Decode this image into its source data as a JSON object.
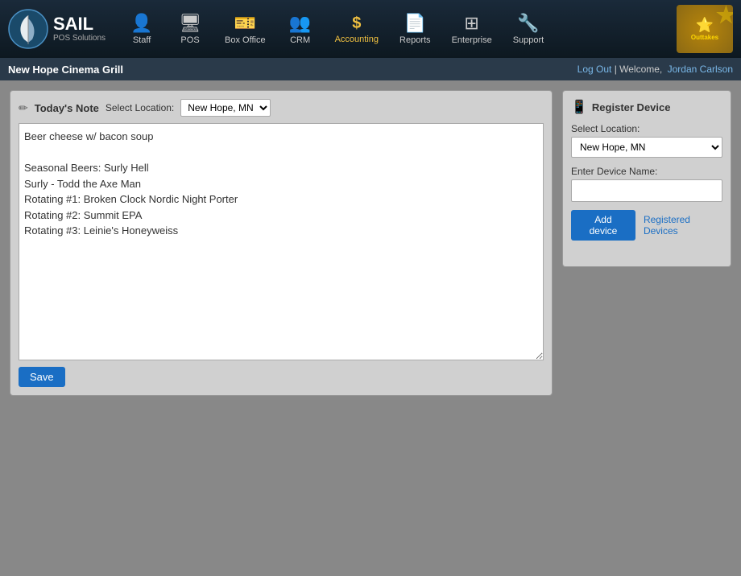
{
  "header": {
    "brand": "SAIL",
    "sub": "POS Solutions",
    "badge_text": "Outtakes",
    "nav": [
      {
        "label": "Staff",
        "icon": "👤",
        "id": "staff"
      },
      {
        "label": "POS",
        "icon": "🖥",
        "id": "pos"
      },
      {
        "label": "Box Office",
        "icon": "🎫",
        "id": "boxoffice"
      },
      {
        "label": "CRM",
        "icon": "👥",
        "id": "crm"
      },
      {
        "label": "Accounting",
        "icon": "$",
        "id": "accounting",
        "active": true
      },
      {
        "label": "Reports",
        "icon": "📄",
        "id": "reports"
      },
      {
        "label": "Enterprise",
        "icon": "🏢",
        "id": "enterprise"
      },
      {
        "label": "Support",
        "icon": "🔧",
        "id": "support"
      }
    ]
  },
  "subheader": {
    "location": "New Hope Cinema Grill",
    "logout_label": "Log Out",
    "welcome_text": "Welcome,",
    "username": "Jordan Carlson"
  },
  "note_panel": {
    "title": "Today's Note",
    "location_label": "Select Location:",
    "location_value": "New Hope, MN",
    "location_options": [
      "New Hope, MN"
    ],
    "content": "Beer cheese w/ bacon soup\n\nSeasonal Beers: Surly Hell\nSurly - Todd the Axe Man\nRotating #1: Broken Clock Nordic Night Porter\nRotating #2: Summit EPA\nRotating #3: Leinie's Honeyweiss",
    "save_label": "Save"
  },
  "register_panel": {
    "title": "Register Device",
    "select_location_label": "Select Location:",
    "location_value": "New Hope, MN",
    "location_options": [
      "New Hope, MN"
    ],
    "device_name_label": "Enter Device Name:",
    "device_name_placeholder": "",
    "add_device_label": "Add device",
    "registered_devices_label": "Registered Devices"
  }
}
